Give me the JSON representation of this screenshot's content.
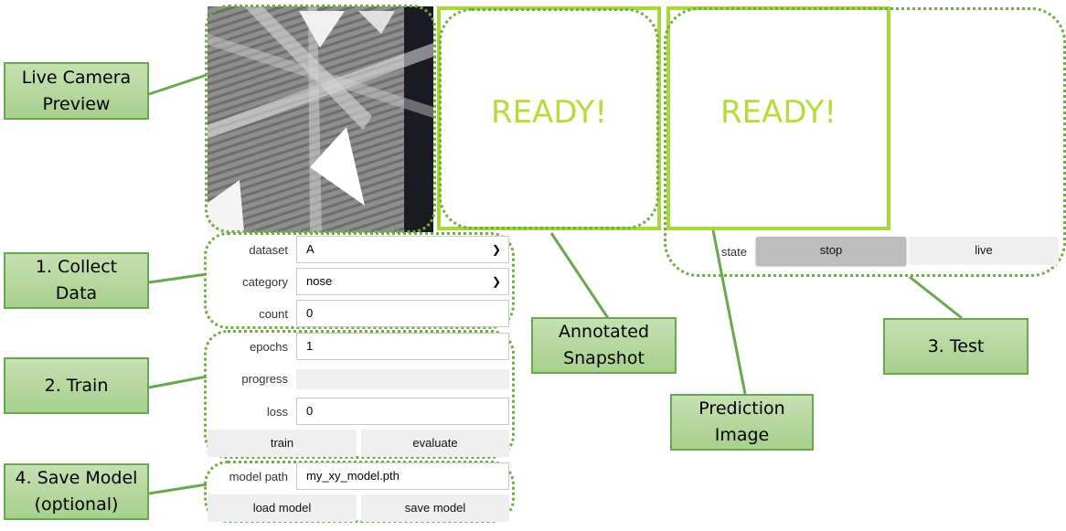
{
  "callouts": {
    "live_camera": "Live Camera\nPreview",
    "collect": "1. Collect\nData",
    "train": "2. Train",
    "save": "4. Save Model\n(optional)",
    "annotated": "Annotated\nSnapshot",
    "prediction": "Prediction\nImage",
    "test": "3. Test"
  },
  "images": {
    "annotated_text": "READY!",
    "prediction_text": "READY!"
  },
  "collect": {
    "dataset_label": "dataset",
    "dataset_value": "A",
    "category_label": "category",
    "category_value": "nose",
    "count_label": "count",
    "count_value": "0"
  },
  "train": {
    "epochs_label": "epochs",
    "epochs_value": "1",
    "progress_label": "progress",
    "progress_fraction": 0,
    "loss_label": "loss",
    "loss_value": "0",
    "train_button": "train",
    "evaluate_button": "evaluate"
  },
  "save": {
    "model_path_label": "model path",
    "model_path_value": "my_xy_model.pth",
    "load_button": "load model",
    "save_button": "save model"
  },
  "test": {
    "state_label": "state",
    "stop_button": "stop",
    "live_button": "live"
  },
  "colors": {
    "callout_fill": "#a8d08d",
    "callout_border": "#6aa84f",
    "group_border": "#70ad47",
    "image_border": "#a8d73a",
    "ready_text": "#b6dc3c",
    "stop_active": "#bdbdbd"
  }
}
